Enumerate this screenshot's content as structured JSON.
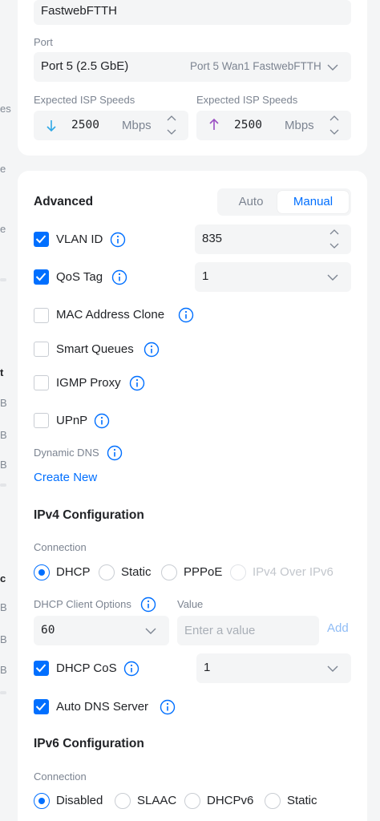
{
  "sidebar_fragments": [
    "es",
    "e",
    "e",
    "t",
    "B",
    "B",
    "B",
    "c",
    "B",
    "B",
    "B"
  ],
  "wan": {
    "network_name": "FastwebFTTH",
    "port_label": "Port",
    "port_value": "Port 5 (2.5 GbE)",
    "port_hint": "Port 5 Wan1 FastwebFTTH",
    "download": {
      "label": "Expected ISP Speeds",
      "value": "2500",
      "unit": "Mbps"
    },
    "upload": {
      "label": "Expected ISP Speeds",
      "value": "2500",
      "unit": "Mbps"
    }
  },
  "advanced": {
    "title": "Advanced",
    "mode_auto": "Auto",
    "mode_manual": "Manual",
    "selected_mode": "Manual",
    "vlan_id": {
      "label": "VLAN ID",
      "checked": true,
      "value": "835"
    },
    "qos_tag": {
      "label": "QoS Tag",
      "checked": true,
      "value": "1"
    },
    "mac_clone": {
      "label": "MAC Address Clone",
      "checked": false
    },
    "smart_queues": {
      "label": "Smart Queues",
      "checked": false
    },
    "igmp_proxy": {
      "label": "IGMP Proxy",
      "checked": false
    },
    "upnp": {
      "label": "UPnP",
      "checked": false
    },
    "dynamic_dns_label": "Dynamic DNS",
    "create_new": "Create New"
  },
  "ipv4": {
    "title": "IPv4 Configuration",
    "connection_label": "Connection",
    "options": [
      "DHCP",
      "Static",
      "PPPoE",
      "IPv4 Over IPv6"
    ],
    "selected": "DHCP",
    "client_options_label": "DHCP Client Options",
    "client_option_value": "60",
    "value_label": "Value",
    "value_placeholder": "Enter a value",
    "add_label": "Add",
    "dhcp_cos": {
      "label": "DHCP CoS",
      "checked": true,
      "value": "1"
    },
    "auto_dns": {
      "label": "Auto DNS Server",
      "checked": true
    }
  },
  "ipv6": {
    "title": "IPv6 Configuration",
    "connection_label": "Connection",
    "options": [
      "Disabled",
      "SLAAC",
      "DHCPv6",
      "Static"
    ],
    "selected": "Disabled"
  },
  "colors": {
    "accent": "#006fff",
    "download_arrow": "#2ea8e6",
    "upload_arrow": "#9b4fc4",
    "muted_text": "#7c8491",
    "field_bg": "#f4f5f6"
  }
}
